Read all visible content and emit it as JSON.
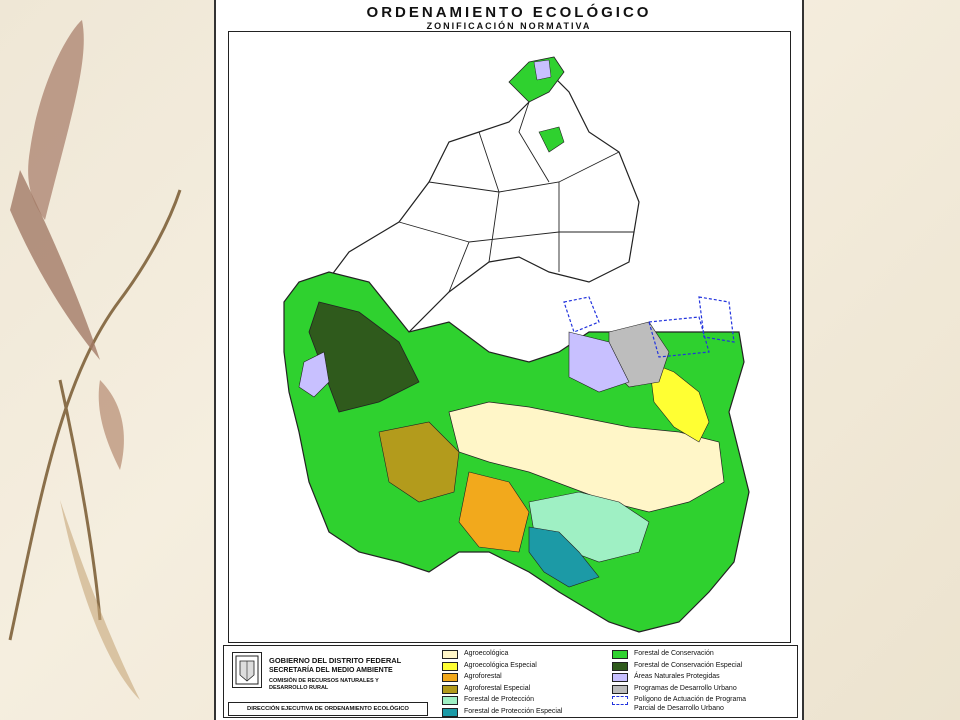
{
  "title": "ORDENAMIENTO ECOLÓGICO",
  "subtitle": "ZONIFICACIÓN NORMATIVA",
  "institution": {
    "government": "GOBIERNO DEL DISTRITO FEDERAL",
    "secretariat": "SECRETARÍA DEL MEDIO AMBIENTE",
    "commission": "COMISIÓN DE RECURSOS NATURALES Y DESARROLLO RURAL",
    "direction": "DIRECCIÓN EJECUTIVA DE ORDENAMIENTO ECOLÓGICO"
  },
  "legend": [
    {
      "label": "Agroecológica",
      "color": "#fff6c8"
    },
    {
      "label": "Agroecológica Especial",
      "color": "#ffff33"
    },
    {
      "label": "Agroforestal",
      "color": "#f2a91c"
    },
    {
      "label": "Agroforestal Especial",
      "color": "#b39b1c"
    },
    {
      "label": "Forestal de Protección",
      "color": "#9ff0c4"
    },
    {
      "label": "Forestal de Protección Especial",
      "color": "#1c9aa6"
    },
    {
      "label": "Forestal de Conservación",
      "color": "#2fd12f"
    },
    {
      "label": "Forestal de Conservación Especial",
      "color": "#2f5a1c"
    },
    {
      "label": "Áreas Naturales Protegidas",
      "color": "#c8c0ff"
    },
    {
      "label": "Programas de Desarrollo Urbano",
      "color": "#bdbdbd"
    },
    {
      "label": "Polígono de Actuación de Programa",
      "label2": "Parcial de Desarrollo Urbano",
      "color": "#ffffff"
    }
  ],
  "colors": {
    "urban_boundary": "#222222",
    "polygon_outline": "#2233dd"
  }
}
